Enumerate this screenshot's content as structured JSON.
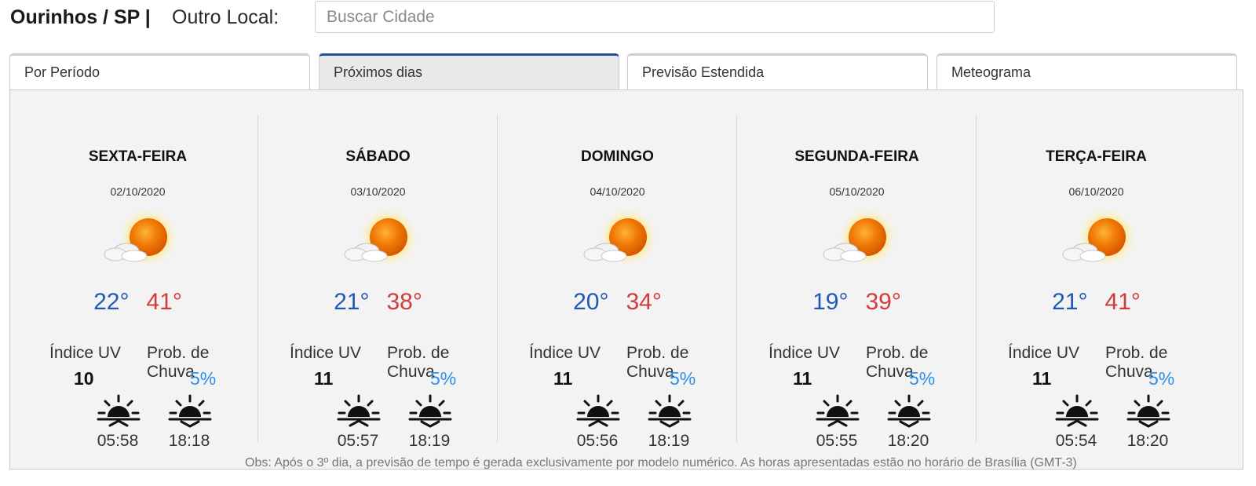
{
  "header": {
    "city": "Ourinhos / SP |",
    "other_location_label": "Outro Local:",
    "search_placeholder": "Buscar Cidade",
    "search_value": ""
  },
  "tabs": [
    {
      "label": "Por Período",
      "active": false
    },
    {
      "label": "Próximos dias",
      "active": true
    },
    {
      "label": "Previsão Estendida",
      "active": false
    },
    {
      "label": "Meteograma",
      "active": false
    }
  ],
  "days": [
    {
      "name": "SEXTA-FEIRA",
      "date": "02/10/2020",
      "icon": "partly-cloudy-sun-icon",
      "min": "22°",
      "max": "41°",
      "uv_label": "Índice UV",
      "uv": "10",
      "rain_label": "Prob. de Chuva",
      "rain": "5%",
      "sunrise": "05:58",
      "sunset": "18:18"
    },
    {
      "name": "SÁBADO",
      "date": "03/10/2020",
      "icon": "partly-cloudy-sun-icon",
      "min": "21°",
      "max": "38°",
      "uv_label": "Índice UV",
      "uv": "11",
      "rain_label": "Prob. de Chuva",
      "rain": "5%",
      "sunrise": "05:57",
      "sunset": "18:19"
    },
    {
      "name": "DOMINGO",
      "date": "04/10/2020",
      "icon": "partly-cloudy-sun-icon",
      "min": "20°",
      "max": "34°",
      "uv_label": "Índice UV",
      "uv": "11",
      "rain_label": "Prob. de Chuva",
      "rain": "5%",
      "sunrise": "05:56",
      "sunset": "18:19"
    },
    {
      "name": "SEGUNDA-FEIRA",
      "date": "05/10/2020",
      "icon": "partly-cloudy-sun-icon",
      "min": "19°",
      "max": "39°",
      "uv_label": "Índice UV",
      "uv": "11",
      "rain_label": "Prob. de Chuva",
      "rain": "5%",
      "sunrise": "05:55",
      "sunset": "18:20"
    },
    {
      "name": "TERÇA-FEIRA",
      "date": "06/10/2020",
      "icon": "partly-cloudy-sun-icon",
      "min": "21°",
      "max": "41°",
      "uv_label": "Índice UV",
      "uv": "11",
      "rain_label": "Prob. de Chuva",
      "rain": "5%",
      "sunrise": "05:54",
      "sunset": "18:20"
    }
  ],
  "footer": {
    "note": "Obs: Após o 3º dia, a previsão de tempo é gerada exclusivamente por modelo numérico. As horas apresentadas estão no horário de Brasília (GMT-3)"
  },
  "colors": {
    "active_tab_border": "#1d4f9c",
    "min_temp": "#1f58b8",
    "max_temp": "#d33b3b",
    "rain_prob": "#2d8fe8",
    "panel_bg": "#f3f3f3"
  }
}
